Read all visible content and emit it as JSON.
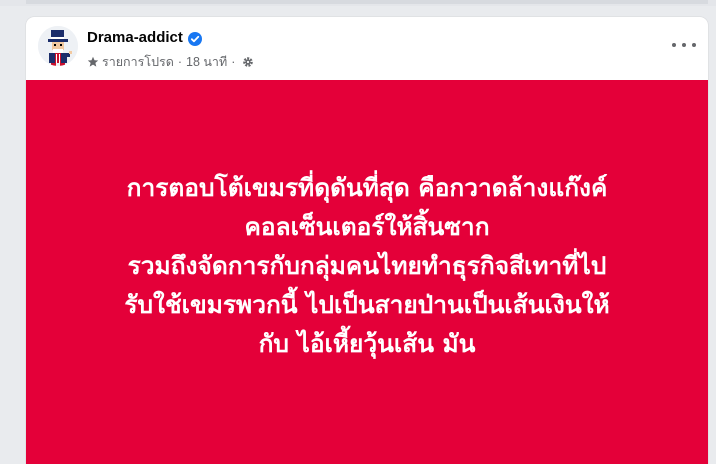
{
  "post": {
    "author_name": "Drama-addict",
    "audience_label": "รายการโปรด",
    "timestamp": "18 นาที",
    "separator": "·",
    "verified_icon": "verified-badge-icon",
    "more_icon": "more-options-icon",
    "background_color": "#e40039",
    "text_lines": [
      "การตอบโต้เขมรที่ดุดันที่สุด คือกวาดล้างแก๊งค์",
      "คอลเซ็นเตอร์ให้สิ้นซาก",
      "รวมถึงจัดการกับกลุ่มคนไทยทำธุรกิจสีเทาที่ไป",
      "รับใช้เขมรพวกนี้ ไปเป็นสายป่านเป็นเส้นเงินให้",
      "กับ ไอ้เหี้ยวุ้นเส้น มัน"
    ]
  }
}
